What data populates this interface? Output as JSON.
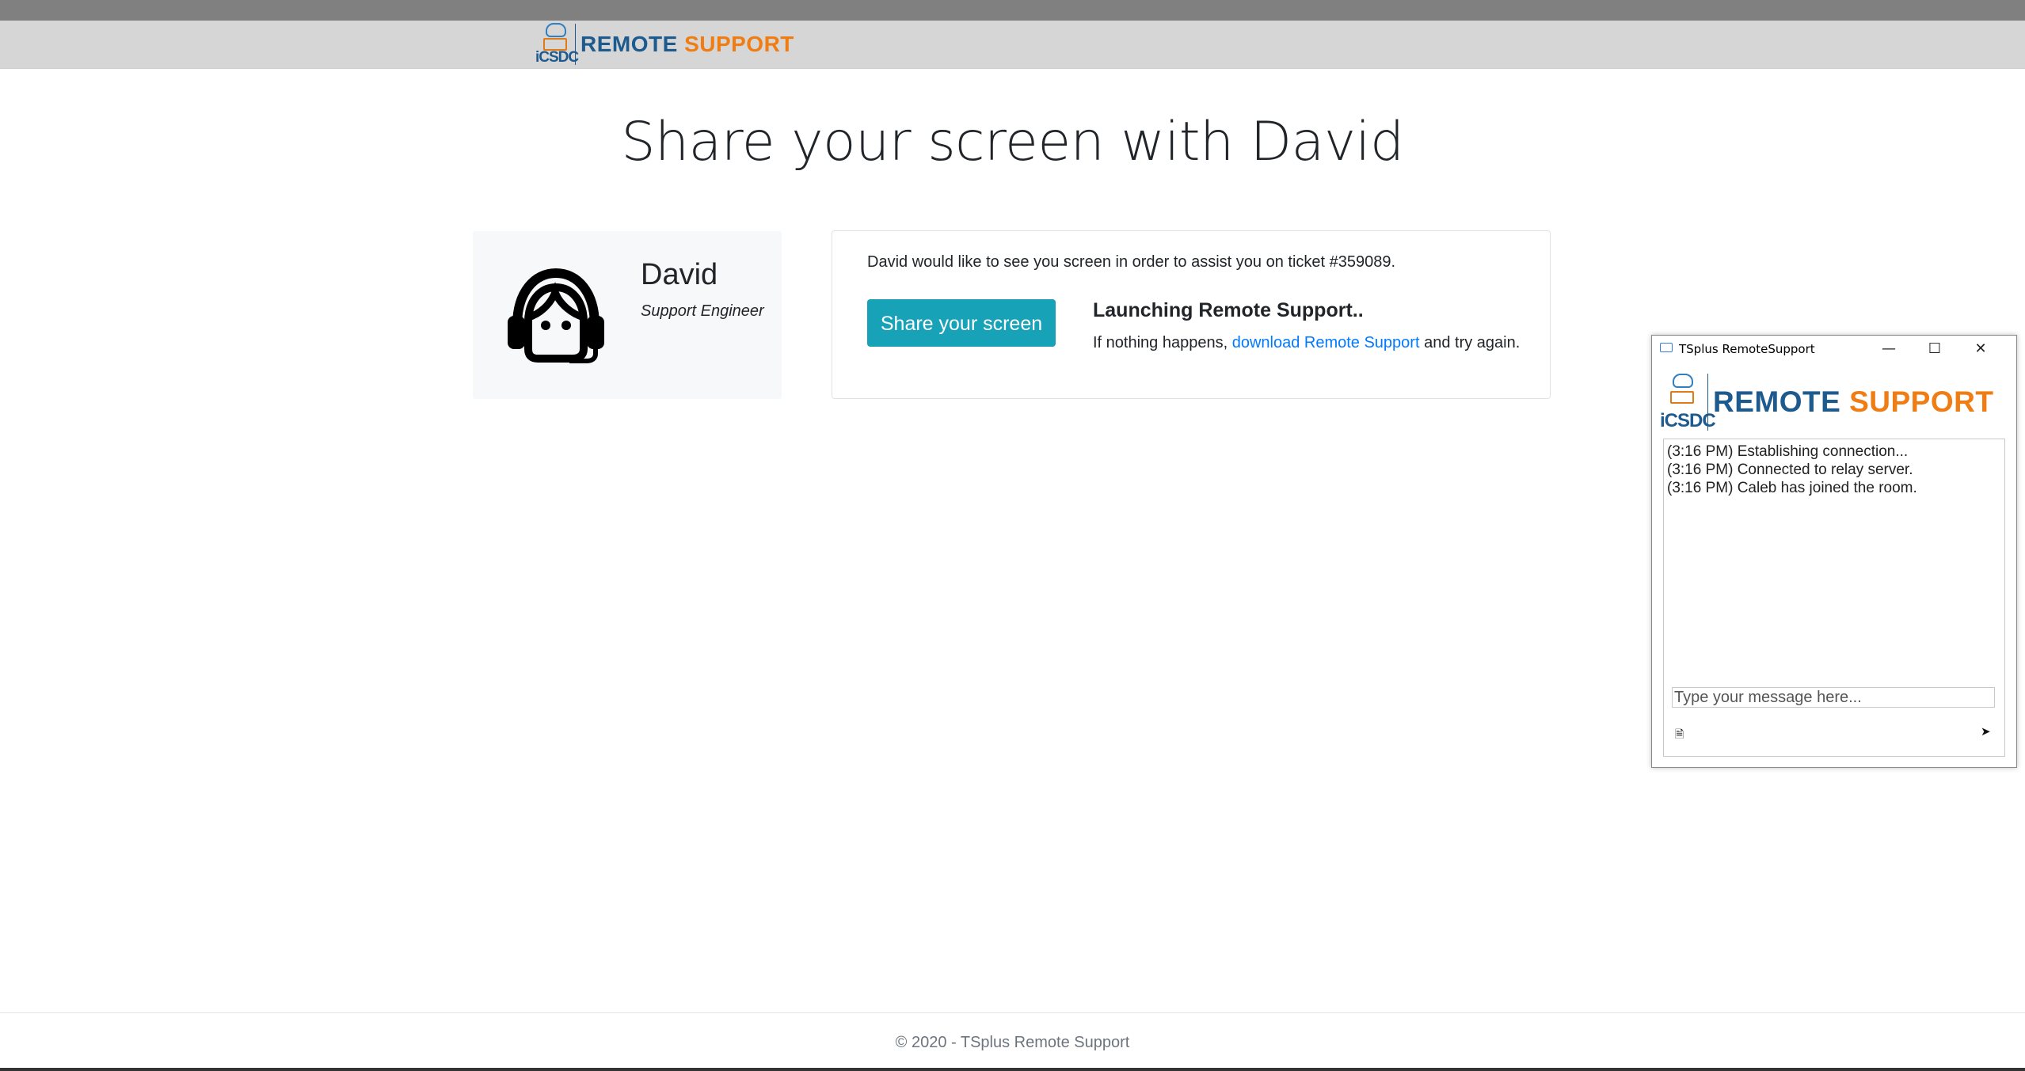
{
  "header": {
    "logo_badge": "iCSDC",
    "logo_word1": "REMOTE",
    "logo_word2": "SUPPORT"
  },
  "page": {
    "title": "Share your screen with David"
  },
  "agent": {
    "name": "David",
    "role": "Support Engineer",
    "icon": "headset-agent-icon"
  },
  "info": {
    "message": "David would like to see you screen in order to assist you on ticket #359089.",
    "share_button": "Share your screen",
    "launch_title": "Launching Remote Support..",
    "launch_prefix": "If nothing happens, ",
    "launch_link": "download Remote Support",
    "launch_suffix": " and try again."
  },
  "footer": {
    "text": "© 2020 - TSplus Remote Support"
  },
  "window": {
    "title": "TSplus RemoteSupport",
    "minimize": "—",
    "maximize": "☐",
    "close": "✕",
    "logo_badge": "iCSDC",
    "logo_word1": "REMOTE",
    "logo_word2": "SUPPORT",
    "log": [
      "(3:16 PM) Establishing connection...",
      "(3:16 PM) Connected to relay server.",
      "(3:16 PM) Caleb has joined the room."
    ],
    "input_placeholder": "Type your message here...",
    "attach_glyph": "🗎",
    "send_glyph": "➤"
  },
  "colors": {
    "brand_blue": "#1d5a8e",
    "brand_orange": "#f07d14",
    "button": "#17a2b8",
    "link": "#007bff"
  }
}
